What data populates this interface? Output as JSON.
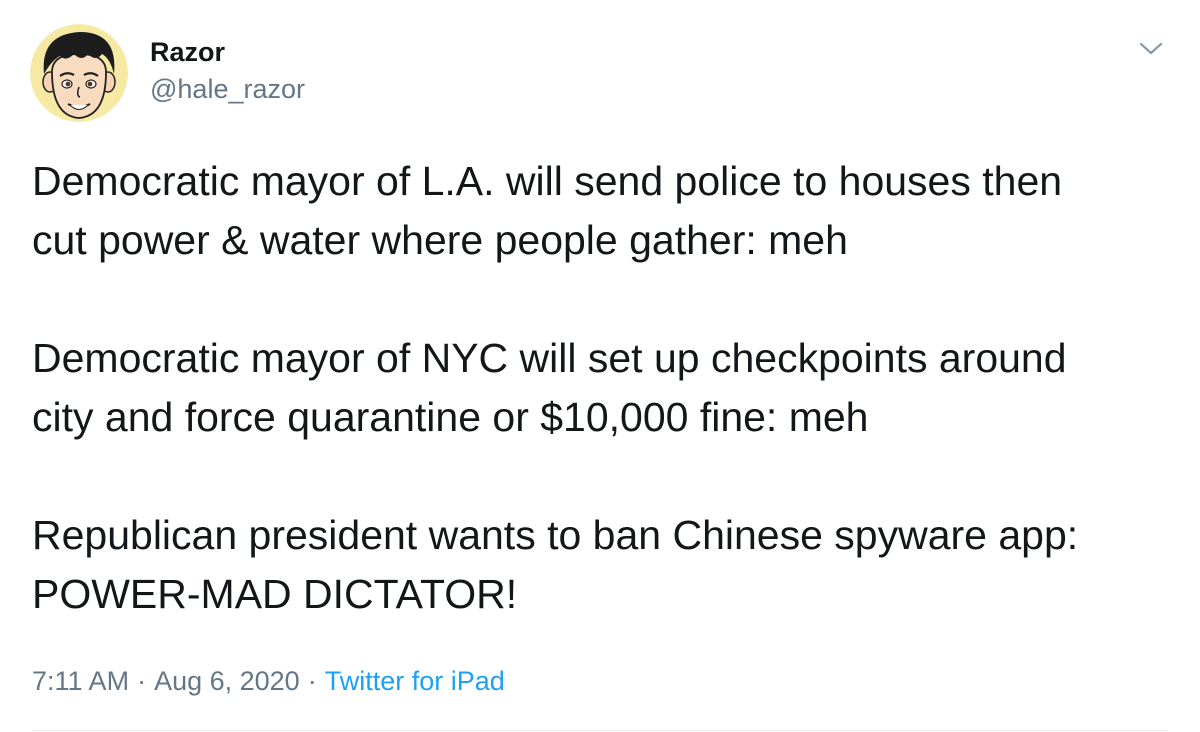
{
  "user": {
    "display_name": "Razor",
    "handle": "@hale_razor"
  },
  "tweet": {
    "paragraphs": [
      [
        "Democratic mayor of L.A. will send police to houses then",
        "cut power & water where people gather: meh"
      ],
      [
        "Democratic mayor of NYC will set up checkpoints around",
        "city and force quarantine or $10,000 fine: meh"
      ],
      [
        "Republican president wants to ban Chinese spyware app:",
        "POWER-MAD DICTATOR!"
      ]
    ]
  },
  "meta": {
    "time": "7:11 AM",
    "separator": "·",
    "date": "Aug 6, 2020",
    "source": "Twitter for iPad"
  },
  "icons": {
    "menu": "chevron-down-icon",
    "avatar": "cartoon-face-avatar"
  },
  "colors": {
    "text": "#14171a",
    "secondary": "#657786",
    "link": "#1da1f2",
    "avatar_bg": "#f5e9a3"
  }
}
